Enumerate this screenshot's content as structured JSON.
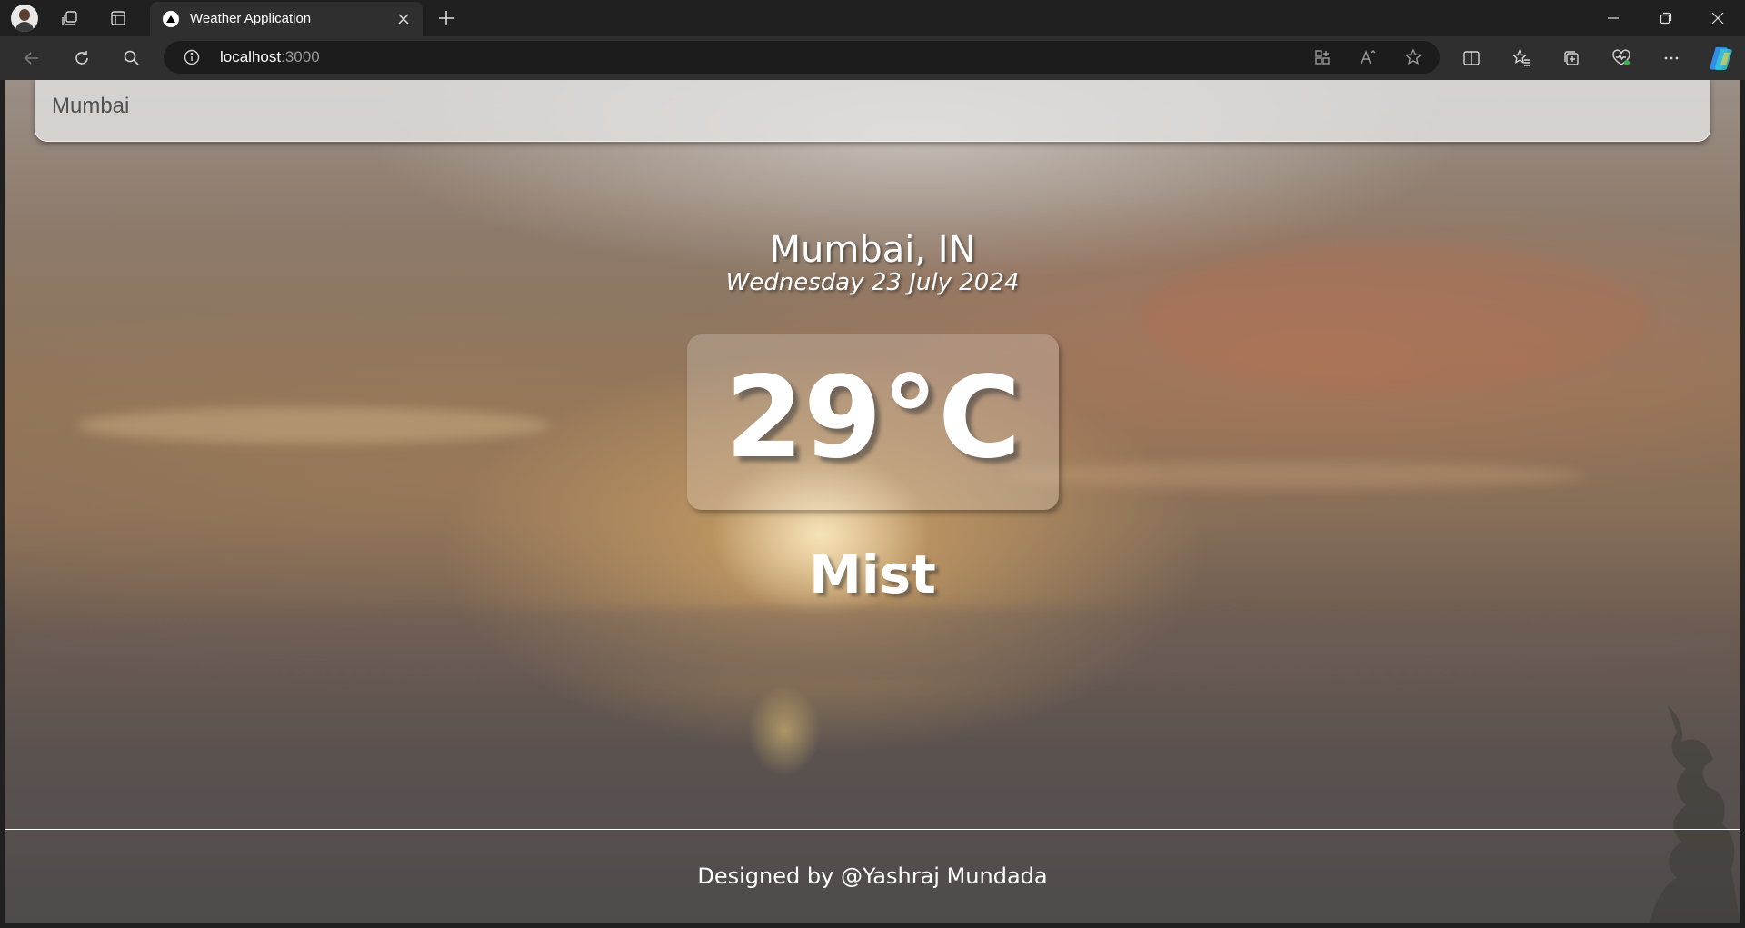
{
  "browser": {
    "tab_title": "Weather Application",
    "url_host": "localhost",
    "url_port": ":3000",
    "icons": [
      "profile-avatar",
      "workspaces-icon",
      "tab-actions-icon",
      "close-icon",
      "new-tab-icon",
      "minimize-icon",
      "restore-icon",
      "window-close-icon",
      "back-icon",
      "refresh-icon",
      "search-icon",
      "site-info-icon",
      "app-available-icon",
      "read-aloud-icon",
      "favorite-star-icon",
      "split-screen-icon",
      "favorites-icon",
      "collections-icon",
      "browser-essentials-icon",
      "more-icon",
      "copilot-icon"
    ]
  },
  "search": {
    "value": "Mumbai"
  },
  "weather": {
    "location": "Mumbai, IN",
    "date": "Wednesday 23 July 2024",
    "temperature": "29°C",
    "condition": "Mist"
  },
  "footer": {
    "credit": "Designed by @Yashraj Mundada"
  }
}
